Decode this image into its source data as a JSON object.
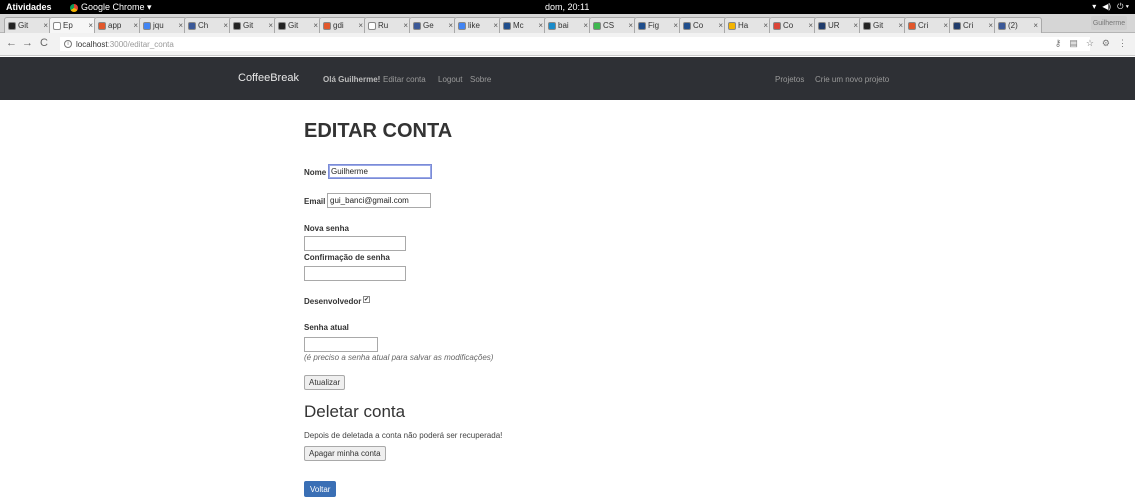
{
  "system_bar": {
    "activities": "Atividades",
    "app_name": "Google Chrome ▾",
    "clock": "dom, 20:11",
    "tray": [
      "▾",
      "◀)",
      "⏻ ▾"
    ]
  },
  "tabs": [
    {
      "label": "Git",
      "color": "#222222"
    },
    {
      "label": "Ep",
      "color": "#ffffff",
      "active": true
    },
    {
      "label": "app",
      "color": "#e2572b"
    },
    {
      "label": "jqu",
      "color": "#4285f4"
    },
    {
      "label": "Ch",
      "color": "#3b5998"
    },
    {
      "label": "Git",
      "color": "#222222"
    },
    {
      "label": "Git",
      "color": "#222222"
    },
    {
      "label": "gdi",
      "color": "#e2572b"
    },
    {
      "label": "Ru",
      "color": "#ffffff"
    },
    {
      "label": "Ge",
      "color": "#3b5998"
    },
    {
      "label": "like",
      "color": "#4285f4"
    },
    {
      "label": "Mc",
      "color": "#1f4e8c"
    },
    {
      "label": "bai",
      "color": "#1a8ccb"
    },
    {
      "label": "CS",
      "color": "#3fb950"
    },
    {
      "label": "Fig",
      "color": "#1f4e8c"
    },
    {
      "label": "Co",
      "color": "#1f4e8c"
    },
    {
      "label": "Ha",
      "color": "#f4b400"
    },
    {
      "label": "Co",
      "color": "#db4437"
    },
    {
      "label": "UR",
      "color": "#1f3b6b"
    },
    {
      "label": "Git",
      "color": "#222222"
    },
    {
      "label": "Cri",
      "color": "#e2572b"
    },
    {
      "label": "Cri",
      "color": "#1f3b6b"
    },
    {
      "label": "(2)",
      "color": "#3b5998"
    }
  ],
  "profile": "Guilherme",
  "address": {
    "host": "localhost",
    "path": ":3000/editar_conta"
  },
  "navbar": {
    "brand": "CoffeeBreak",
    "greeting": "Olá Guilherme!",
    "edit_account": "Editar conta",
    "logout": "Logout",
    "about": "Sobre",
    "projects": "Projetos",
    "new_project": "Crie um novo projeto"
  },
  "form": {
    "title": "EDITAR CONTA",
    "name_label": "Nome",
    "name_value": "Guilherme",
    "email_label": "Email",
    "email_value": "gui_banci@gmail.com",
    "new_password_label": "Nova senha",
    "confirm_password_label": "Confirmação de senha",
    "developer_label": "Desenvolvedor",
    "developer_checked": true,
    "current_password_label": "Senha atual",
    "current_password_hint": "(é preciso a senha atual para salvar as modificações)",
    "update_button": "Atualizar"
  },
  "delete": {
    "title": "Deletar conta",
    "warning": "Depois de deletada a conta não poderá ser recuperada!",
    "delete_button": "Apagar minha conta"
  },
  "back_button": "Voltar"
}
